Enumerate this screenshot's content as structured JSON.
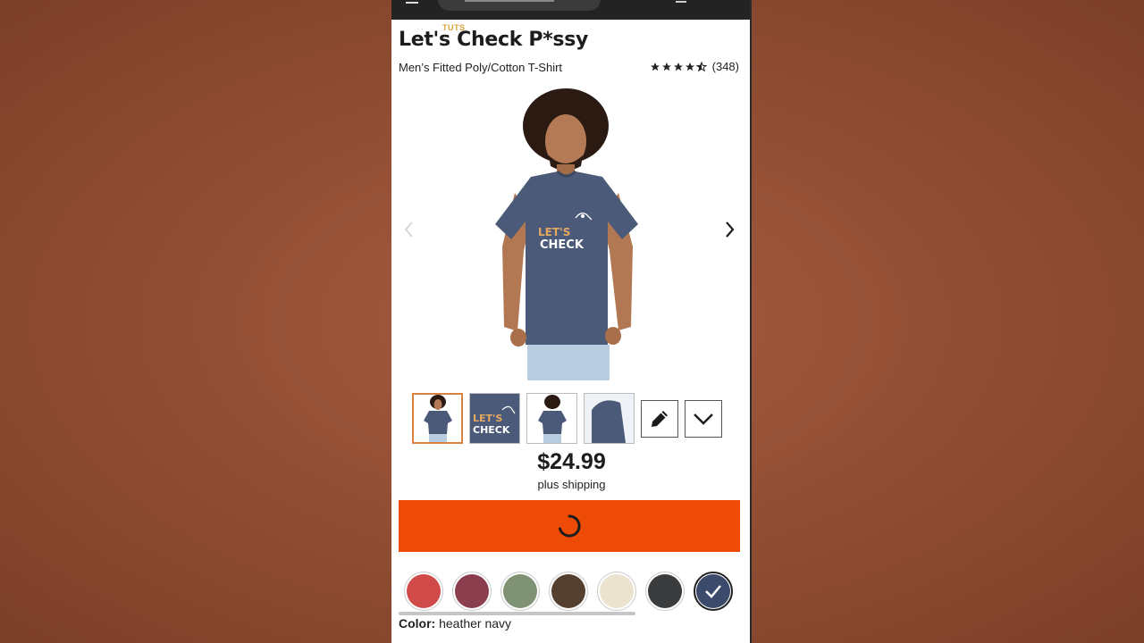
{
  "watermark": "TUTS",
  "product": {
    "title": "Let's Check P*ssy",
    "subtitle": "Men’s Fitted Poly/Cotton T-Shirt",
    "rating_stars": 4.5,
    "rating_count": "(348)",
    "print_line1": "LET'S",
    "print_line2": "CHECK",
    "price": "$24.99",
    "shipping": "plus shipping"
  },
  "thumbnails": [
    {
      "name": "front-model",
      "active": true
    },
    {
      "name": "design-closeup",
      "active": false
    },
    {
      "name": "back-model",
      "active": false
    },
    {
      "name": "fabric-detail",
      "active": false
    }
  ],
  "thumb_actions": [
    {
      "icon": "pencil-icon"
    },
    {
      "icon": "chevron-down-icon"
    }
  ],
  "cart_button": {
    "state": "loading",
    "icon": "spinner-icon"
  },
  "colors": {
    "label": "Color:",
    "selected": "heather navy",
    "swatches": [
      {
        "color": "#d14a4a"
      },
      {
        "color": "#8b3f4e"
      },
      {
        "color": "#7f9374"
      },
      {
        "color": "#55402f"
      },
      {
        "color": "#ece3cf"
      },
      {
        "color": "#3a3b3d"
      },
      {
        "color": "#3c4a6b",
        "selected": true
      }
    ]
  },
  "theme": {
    "accent": "#ee4b07",
    "active_thumb_border": "#d9823f",
    "shirt": "#4b5a78",
    "backdrop": "#9a5a40"
  }
}
